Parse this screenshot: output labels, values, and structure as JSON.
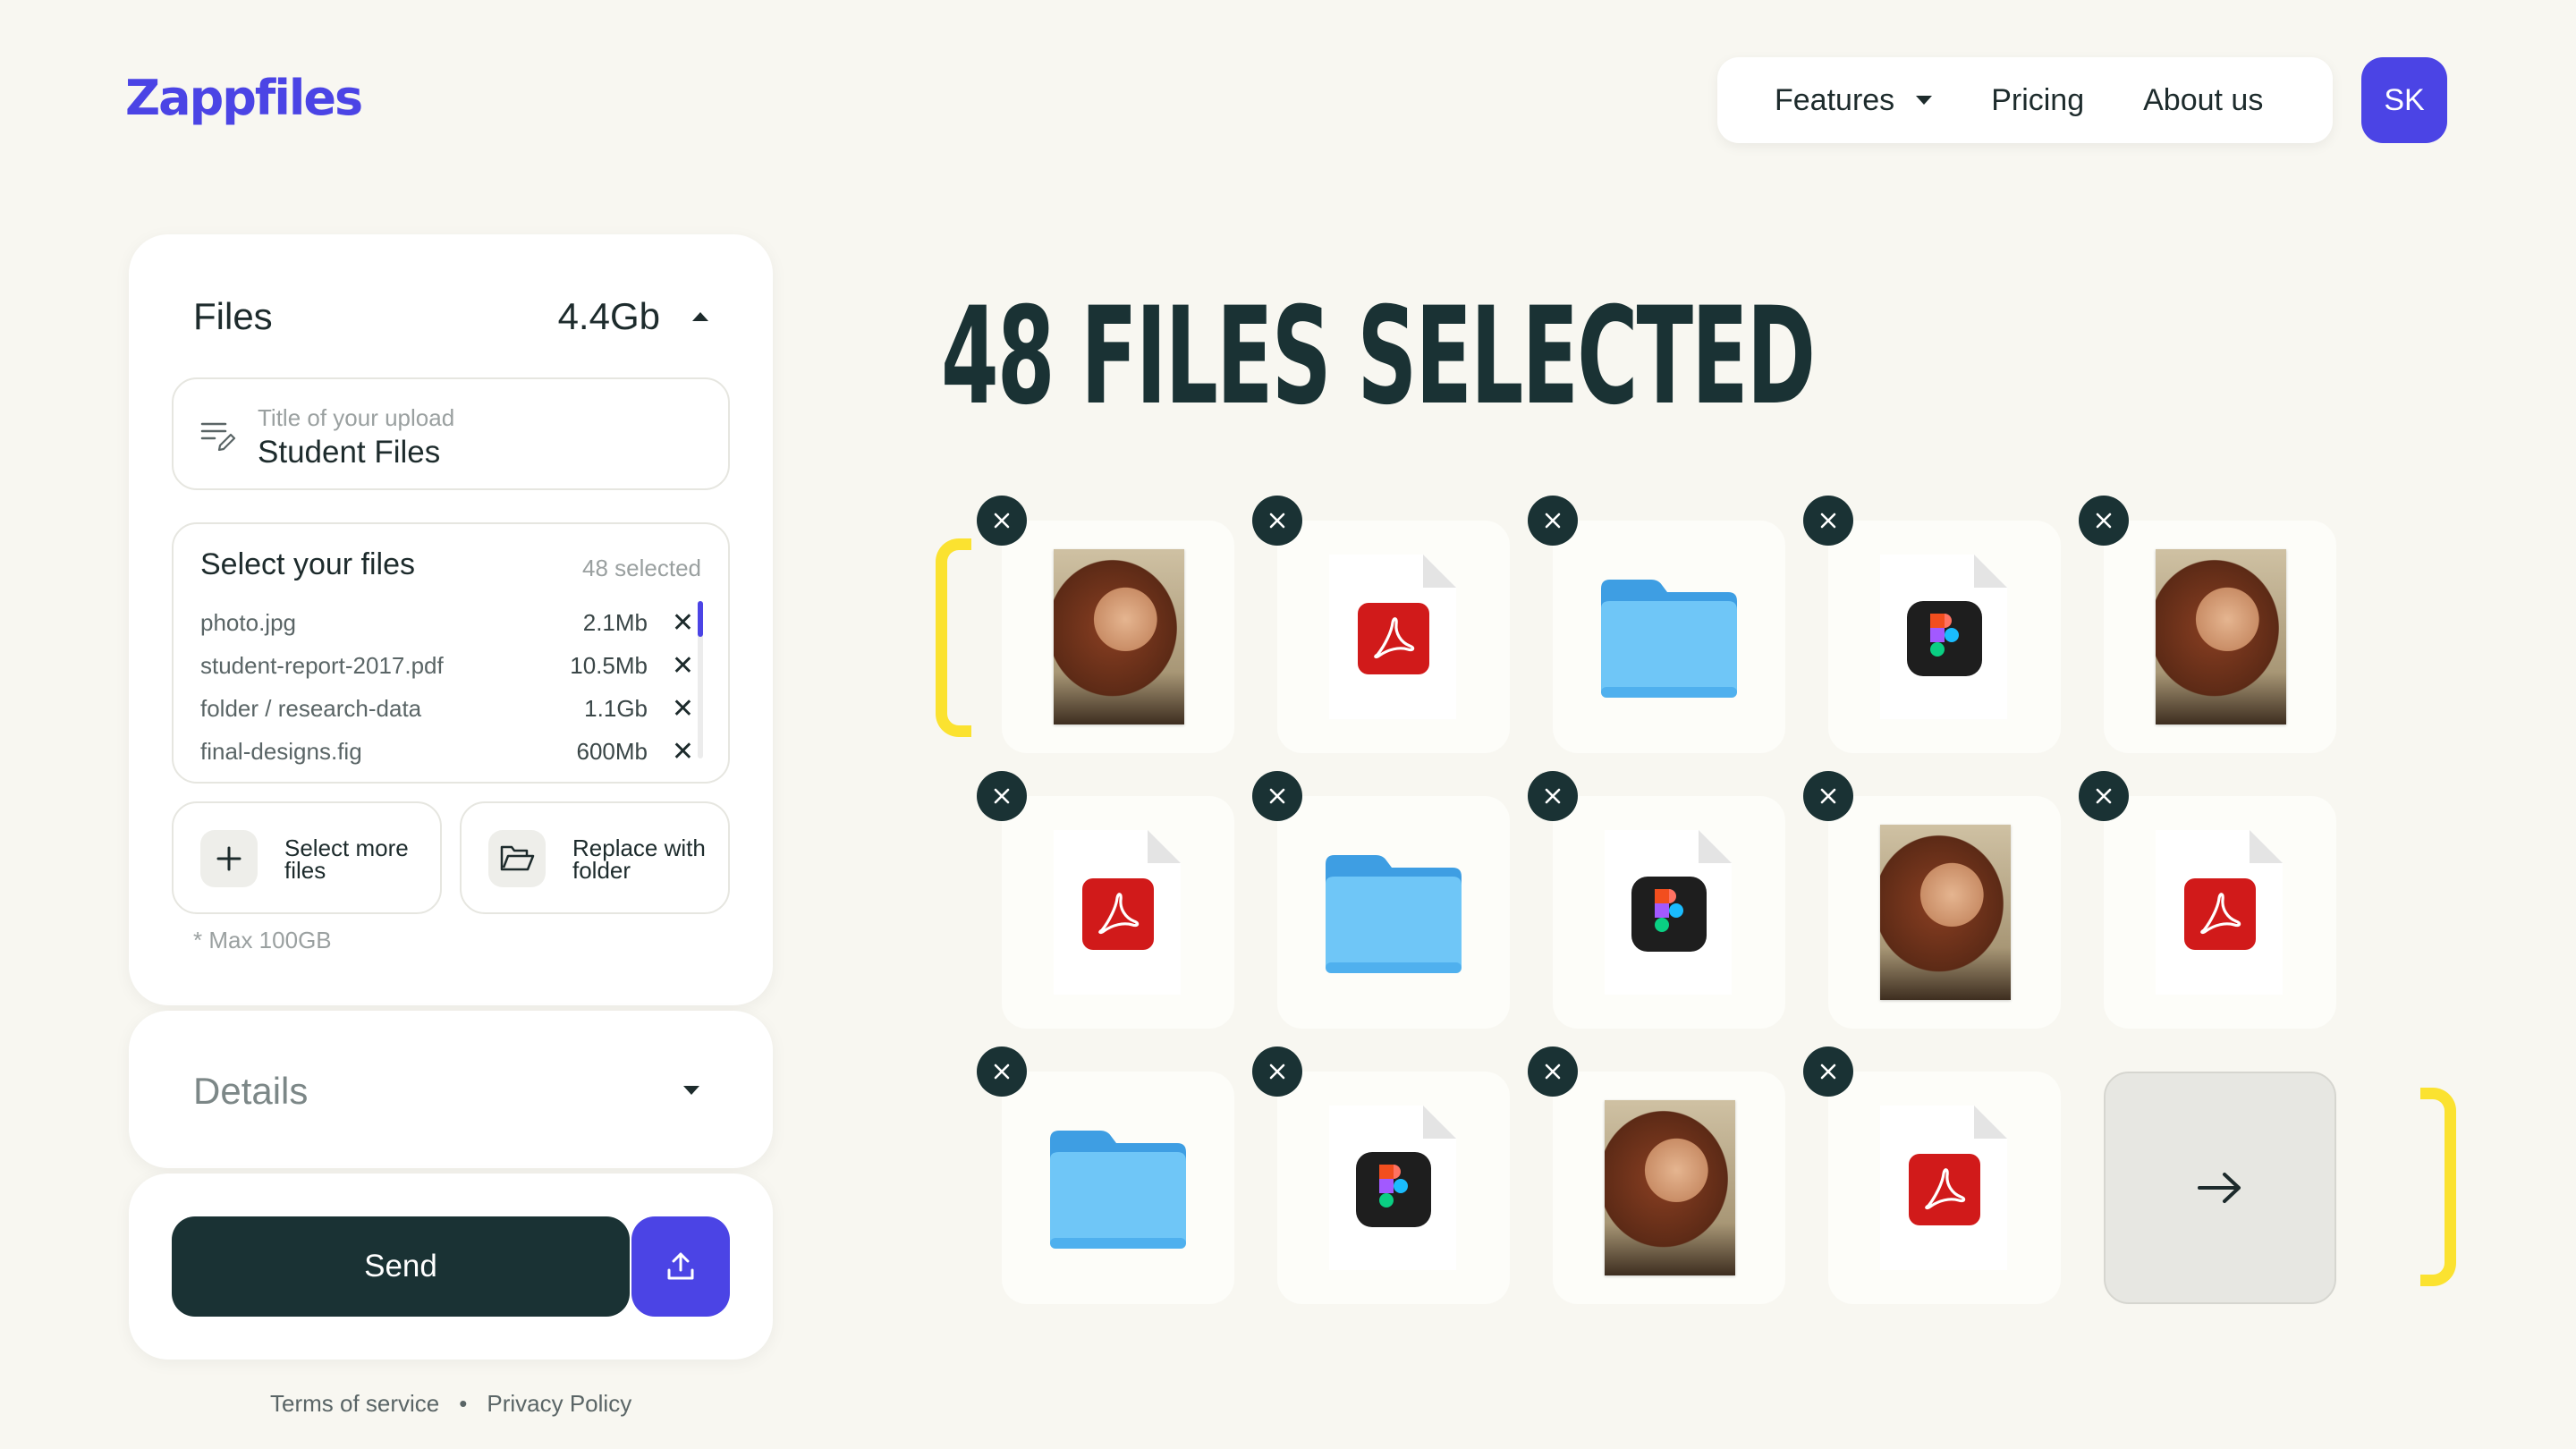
{
  "app": {
    "logo": "Zappfiles",
    "brand_color": "#4b44e5",
    "accent_yellow": "#fbe230",
    "dark_color": "#1a3234"
  },
  "nav": {
    "features": "Features",
    "pricing": "Pricing",
    "about": "About us",
    "avatar_initials": "SK"
  },
  "files_panel": {
    "title": "Files",
    "total_size": "4.4Gb",
    "upload_title_placeholder": "Title of your upload",
    "upload_title_value": "Student Files",
    "select_title": "Select your files",
    "selected_count": "48 selected",
    "files": [
      {
        "name": "photo.jpg",
        "size": "2.1Mb"
      },
      {
        "name": "student-report-2017.pdf",
        "size": "10.5Mb"
      },
      {
        "name": "folder / research-data",
        "size": "1.1Gb"
      },
      {
        "name": "final-designs.fig",
        "size": "600Mb"
      }
    ],
    "select_more_label": "Select more files",
    "replace_folder_label": "Replace with folder",
    "max_note": "* Max 100GB"
  },
  "details": {
    "title": "Details"
  },
  "send": {
    "label": "Send"
  },
  "footer": {
    "terms": "Terms of service",
    "separator": "•",
    "privacy": "Privacy Policy"
  },
  "main": {
    "headline": "48 FILES SELECTED",
    "tiles": [
      {
        "type": "photo"
      },
      {
        "type": "pdf"
      },
      {
        "type": "folder"
      },
      {
        "type": "figma"
      },
      {
        "type": "photo"
      },
      {
        "type": "pdf"
      },
      {
        "type": "folder"
      },
      {
        "type": "figma"
      },
      {
        "type": "photo"
      },
      {
        "type": "pdf"
      },
      {
        "type": "folder"
      },
      {
        "type": "figma"
      },
      {
        "type": "photo"
      },
      {
        "type": "pdf"
      }
    ],
    "next_icon": "arrow-right-icon"
  }
}
